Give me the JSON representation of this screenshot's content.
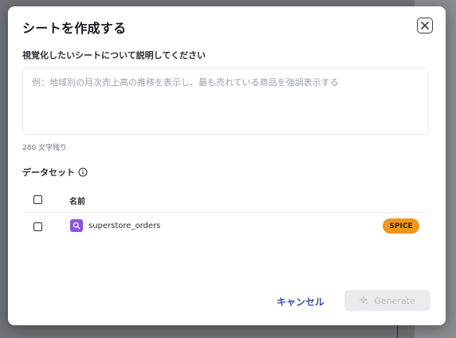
{
  "dialog": {
    "title": "シートを作成する"
  },
  "prompt": {
    "label": "視覚化したいシートについて説明してください",
    "placeholder": "例：地域別の月次売上高の推移を表示し、最も売れている商品を強調表示する",
    "counter": "280 文字残り"
  },
  "datasets": {
    "header": "データセット",
    "column_name": "名前",
    "rows": [
      {
        "name": "superstore_orders",
        "badge": "SPICE",
        "checked": false
      }
    ]
  },
  "actions": {
    "cancel_label": "キャンセル",
    "generate_label": "Generate"
  },
  "colors": {
    "accent": "#3f4fa8",
    "spice_badge": "#f0961c",
    "dataset_icon": "#8a54d6"
  }
}
